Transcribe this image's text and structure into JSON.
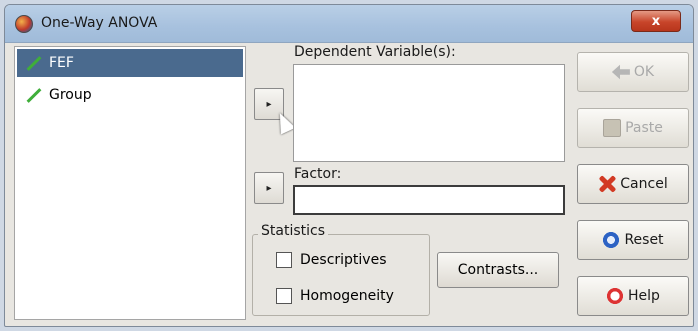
{
  "window": {
    "title": "One-Way ANOVA",
    "close_label": "x"
  },
  "variables": [
    {
      "name": "FEF",
      "selected": true,
      "icon": "scale-pencil-icon"
    },
    {
      "name": "Group",
      "selected": false,
      "icon": "scale-pencil-icon"
    }
  ],
  "dependent": {
    "label": "Dependent Variable(s):",
    "arrow": "▸"
  },
  "factor": {
    "label": "Factor:",
    "value": "",
    "arrow": "▸"
  },
  "statistics": {
    "legend": "Statistics",
    "options": [
      {
        "label": "Descriptives",
        "checked": false
      },
      {
        "label": "Homogeneity",
        "checked": false
      }
    ]
  },
  "contrasts_label": "Contrasts...",
  "actions": {
    "ok": {
      "label": "OK",
      "enabled": false
    },
    "paste": {
      "label": "Paste",
      "enabled": false
    },
    "cancel": {
      "label": "Cancel",
      "enabled": true
    },
    "reset": {
      "label": "Reset",
      "enabled": true
    },
    "help": {
      "label": "Help",
      "enabled": true
    }
  }
}
